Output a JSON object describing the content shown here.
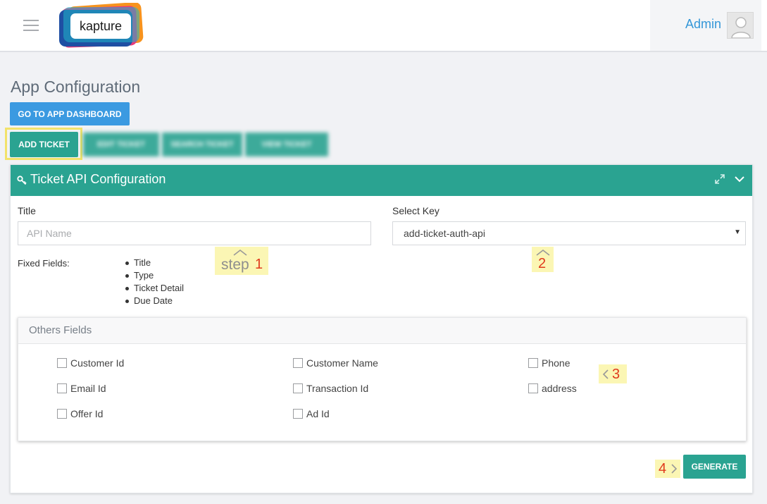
{
  "header": {
    "logo_text": "kapture",
    "user_name": "Admin"
  },
  "page": {
    "title": "App Configuration",
    "dashboard_button": "GO TO APP DASHBOARD"
  },
  "tabs": [
    {
      "label": "ADD TICKET",
      "active": true
    },
    {
      "label": "EDIT TICKET",
      "active": false
    },
    {
      "label": "SEARCH TICKET",
      "active": false
    },
    {
      "label": "VIEW TICKET",
      "active": false
    }
  ],
  "panel": {
    "title": "Ticket API Configuration",
    "title_label": "Title",
    "title_placeholder": "API Name",
    "select_key_label": "Select Key",
    "select_key_value": "add-ticket-auth-api",
    "fixed_fields_label": "Fixed Fields:",
    "fixed_fields": [
      "Title",
      "Type",
      "Ticket Detail",
      "Due Date"
    ],
    "others_title": "Others Fields",
    "others_fields": [
      {
        "label": "Customer Id",
        "checked": false
      },
      {
        "label": "Customer Name",
        "checked": false
      },
      {
        "label": "Phone",
        "checked": false
      },
      {
        "label": "Email Id",
        "checked": false
      },
      {
        "label": "Transaction Id",
        "checked": false
      },
      {
        "label": "address",
        "checked": false
      },
      {
        "label": "Offer Id",
        "checked": false
      },
      {
        "label": "Ad Id",
        "checked": false
      }
    ],
    "generate_button": "GENERATE"
  },
  "annotations": {
    "step1_word": "step",
    "step1_num": "1",
    "step2_num": "2",
    "step3_num": "3",
    "step4_num": "4"
  },
  "colors": {
    "teal": "#2aa391",
    "blue": "#3b9ae1",
    "callout_bg": "#fbf6b4",
    "callout_text": "#e03a1d"
  }
}
